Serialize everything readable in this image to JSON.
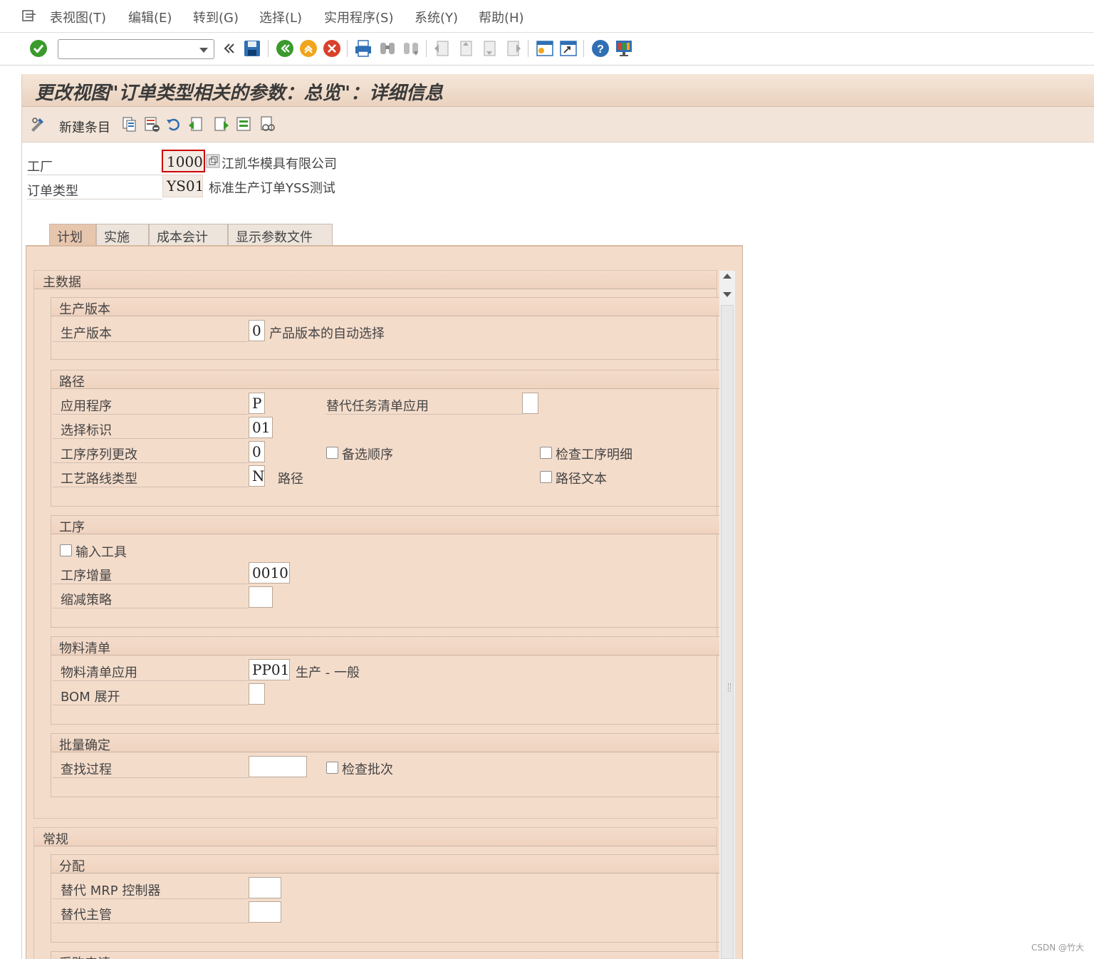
{
  "menubar": {
    "items": [
      "表视图(T)",
      "编辑(E)",
      "转到(G)",
      "选择(L)",
      "实用程序(S)",
      "系统(Y)",
      "帮助(H)"
    ]
  },
  "toolbar": {
    "command_field_value": "",
    "icons": [
      "enter-icon",
      "back-icon",
      "save-icon",
      "exit-icon",
      "logoff-icon",
      "cancel-icon",
      "print-icon",
      "find-icon",
      "find-next-icon",
      "first-page-icon",
      "previous-page-icon",
      "next-page-icon",
      "last-page-icon",
      "create-session-icon",
      "shortcut-icon",
      "help-icon",
      "customize-layout-icon"
    ]
  },
  "screen": {
    "title": "更改视图\"订单类型相关的参数：总览\"：详细信息",
    "new_entries_label": "新建条目"
  },
  "header": {
    "plant_label": "工厂",
    "plant_value": "1000",
    "plant_desc": "江凯华模具有限公司",
    "order_type_label": "订单类型",
    "order_type_value": "YS01",
    "order_type_desc": "标准生产订单YSS测试"
  },
  "tabs": [
    {
      "label": "计划",
      "active": true
    },
    {
      "label": "实施",
      "active": false
    },
    {
      "label": "成本会计",
      "active": false
    },
    {
      "label": "显示参数文件",
      "active": false
    }
  ],
  "master_data": {
    "title": "主数据",
    "prod_version": {
      "title": "生产版本",
      "field_label": "生产版本",
      "value": "0",
      "desc": "产品版本的自动选择"
    },
    "routing": {
      "title": "路径",
      "application_label": "应用程序",
      "application_value": "P",
      "alt_task_list_label": "替代任务清单应用",
      "alt_task_list_value": "",
      "selection_id_label": "选择标识",
      "selection_id_value": "01",
      "seq_change_label": "工序序列更改",
      "seq_change_value": "0",
      "alt_sequence_label": "备选顺序",
      "check_op_detail_label": "检查工序明细",
      "routing_type_label": "工艺路线类型",
      "routing_type_value": "N",
      "routing_type_desc": "路径",
      "routing_text_label": "路径文本"
    },
    "operation": {
      "title": "工序",
      "enter_tool_label": "输入工具",
      "op_increment_label": "工序增量",
      "op_increment_value": "0010",
      "scrap_strategy_label": "缩减策略",
      "scrap_strategy_value": ""
    },
    "bom": {
      "title": "物料清单",
      "bom_app_label": "物料清单应用",
      "bom_app_value": "PP01",
      "bom_app_desc": "生产 - 一般",
      "bom_explode_label": "BOM 展开",
      "bom_explode_value": ""
    },
    "batch": {
      "title": "批量确定",
      "search_proc_label": "查找过程",
      "search_proc_value": "",
      "check_batch_label": "检查批次"
    }
  },
  "general": {
    "title": "常规",
    "assignment": {
      "title": "分配",
      "alt_mrp_label": "替代 MRP 控制器",
      "alt_mrp_value": "",
      "alt_supervisor_label": "替代主管",
      "alt_supervisor_value": ""
    },
    "purchase_req": {
      "title": "采购申请"
    }
  },
  "watermark": "CSDN @竹大",
  "colors": {
    "panel_bg": "#f4dccb",
    "title_bg": "#ead2bf",
    "active_tab": "#e7c6ae",
    "required_marker": "#cc0000",
    "enter_green": "#3a9a2c"
  }
}
